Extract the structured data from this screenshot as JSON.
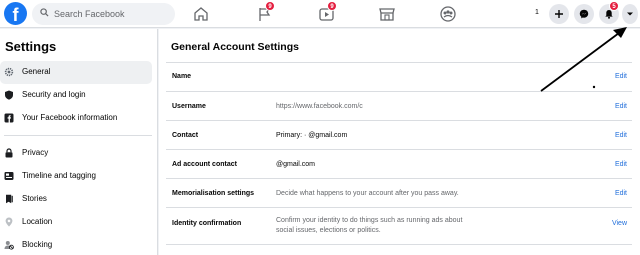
{
  "header": {
    "logo_letter": "f",
    "search": {
      "placeholder": "Search Facebook"
    },
    "nav": [
      {
        "name": "home",
        "icon": "home-icon"
      },
      {
        "name": "pages",
        "icon": "flag-icon",
        "badge": "9"
      },
      {
        "name": "watch",
        "icon": "video-icon",
        "badge": "9"
      },
      {
        "name": "marketplace",
        "icon": "store-icon"
      },
      {
        "name": "groups",
        "icon": "groups-icon"
      }
    ],
    "count_text": "1",
    "actions": [
      {
        "name": "create",
        "icon": "plus-icon"
      },
      {
        "name": "messenger",
        "icon": "messenger-icon"
      },
      {
        "name": "notifications",
        "icon": "bell-icon",
        "badge": "5"
      },
      {
        "name": "account-menu",
        "icon": "caret-down-icon"
      }
    ]
  },
  "sidebar": {
    "title": "Settings",
    "items": [
      {
        "label": "General",
        "icon": "gear-icon",
        "active": true
      },
      {
        "label": "Security and login",
        "icon": "shield-icon"
      },
      {
        "label": "Your Facebook information",
        "icon": "facebook-icon"
      },
      {
        "label": "Privacy",
        "icon": "lock-icon"
      },
      {
        "label": "Timeline and tagging",
        "icon": "timeline-icon"
      },
      {
        "label": "Stories",
        "icon": "book-icon"
      },
      {
        "label": "Location",
        "icon": "location-pin-icon"
      },
      {
        "label": "Blocking",
        "icon": "blocking-icon"
      }
    ]
  },
  "main": {
    "title": "General Account Settings",
    "rows": [
      {
        "label": "Name",
        "value": "",
        "action": "Edit"
      },
      {
        "label": "Username",
        "value": "https://www.facebook.com/c",
        "action": "Edit"
      },
      {
        "label": "Contact",
        "value": "Primary: ·               @gmail.com",
        "action": "Edit"
      },
      {
        "label": "Ad account contact",
        "value": "                    @gmail.com",
        "action": "Edit"
      },
      {
        "label": "Memorialisation settings",
        "value": "Decide what happens to your account after you pass away.",
        "action": "Edit"
      },
      {
        "label": "Identity confirmation",
        "value_line1": "Confirm your identity to do things such as running ads about",
        "value_line2": "social issues, elections or politics.",
        "action": "View"
      }
    ]
  },
  "colors": {
    "brand": "#1877f2",
    "link": "#216fdb",
    "badge": "#e41e3f",
    "page_bg": "#f0f2f5",
    "annotation": "#000000"
  }
}
